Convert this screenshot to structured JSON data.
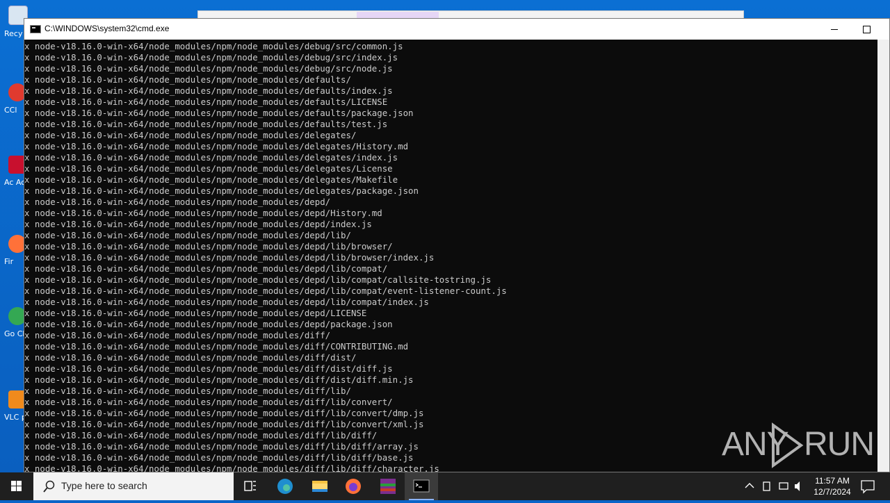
{
  "desktop": {
    "icons": [
      {
        "name": "recycle-bin",
        "label": "Recy"
      },
      {
        "name": "ccleaner",
        "label": "CCl"
      },
      {
        "name": "acrobat",
        "label": "Ac Acr"
      },
      {
        "name": "firefox",
        "label": "Fir"
      },
      {
        "name": "chrome",
        "label": "Go Chr"
      },
      {
        "name": "vlc",
        "label": "VLC pl"
      }
    ]
  },
  "window": {
    "title": "C:\\WINDOWS\\system32\\cmd.exe"
  },
  "console": {
    "lines": [
      "x node-v18.16.0-win-x64/node_modules/npm/node_modules/debug/src/common.js",
      "x node-v18.16.0-win-x64/node_modules/npm/node_modules/debug/src/index.js",
      "x node-v18.16.0-win-x64/node_modules/npm/node_modules/debug/src/node.js",
      "x node-v18.16.0-win-x64/node_modules/npm/node_modules/defaults/",
      "x node-v18.16.0-win-x64/node_modules/npm/node_modules/defaults/index.js",
      "x node-v18.16.0-win-x64/node_modules/npm/node_modules/defaults/LICENSE",
      "x node-v18.16.0-win-x64/node_modules/npm/node_modules/defaults/package.json",
      "x node-v18.16.0-win-x64/node_modules/npm/node_modules/defaults/test.js",
      "x node-v18.16.0-win-x64/node_modules/npm/node_modules/delegates/",
      "x node-v18.16.0-win-x64/node_modules/npm/node_modules/delegates/History.md",
      "x node-v18.16.0-win-x64/node_modules/npm/node_modules/delegates/index.js",
      "x node-v18.16.0-win-x64/node_modules/npm/node_modules/delegates/License",
      "x node-v18.16.0-win-x64/node_modules/npm/node_modules/delegates/Makefile",
      "x node-v18.16.0-win-x64/node_modules/npm/node_modules/delegates/package.json",
      "x node-v18.16.0-win-x64/node_modules/npm/node_modules/depd/",
      "x node-v18.16.0-win-x64/node_modules/npm/node_modules/depd/History.md",
      "x node-v18.16.0-win-x64/node_modules/npm/node_modules/depd/index.js",
      "x node-v18.16.0-win-x64/node_modules/npm/node_modules/depd/lib/",
      "x node-v18.16.0-win-x64/node_modules/npm/node_modules/depd/lib/browser/",
      "x node-v18.16.0-win-x64/node_modules/npm/node_modules/depd/lib/browser/index.js",
      "x node-v18.16.0-win-x64/node_modules/npm/node_modules/depd/lib/compat/",
      "x node-v18.16.0-win-x64/node_modules/npm/node_modules/depd/lib/compat/callsite-tostring.js",
      "x node-v18.16.0-win-x64/node_modules/npm/node_modules/depd/lib/compat/event-listener-count.js",
      "x node-v18.16.0-win-x64/node_modules/npm/node_modules/depd/lib/compat/index.js",
      "x node-v18.16.0-win-x64/node_modules/npm/node_modules/depd/LICENSE",
      "x node-v18.16.0-win-x64/node_modules/npm/node_modules/depd/package.json",
      "x node-v18.16.0-win-x64/node_modules/npm/node_modules/diff/",
      "x node-v18.16.0-win-x64/node_modules/npm/node_modules/diff/CONTRIBUTING.md",
      "x node-v18.16.0-win-x64/node_modules/npm/node_modules/diff/dist/",
      "x node-v18.16.0-win-x64/node_modules/npm/node_modules/diff/dist/diff.js",
      "x node-v18.16.0-win-x64/node_modules/npm/node_modules/diff/dist/diff.min.js",
      "x node-v18.16.0-win-x64/node_modules/npm/node_modules/diff/lib/",
      "x node-v18.16.0-win-x64/node_modules/npm/node_modules/diff/lib/convert/",
      "x node-v18.16.0-win-x64/node_modules/npm/node_modules/diff/lib/convert/dmp.js",
      "x node-v18.16.0-win-x64/node_modules/npm/node_modules/diff/lib/convert/xml.js",
      "x node-v18.16.0-win-x64/node_modules/npm/node_modules/diff/lib/diff/",
      "x node-v18.16.0-win-x64/node_modules/npm/node_modules/diff/lib/diff/array.js",
      "x node-v18.16.0-win-x64/node_modules/npm/node_modules/diff/lib/diff/base.js",
      "x node-v18.16.0-win-x64/node_modules/npm/node_modules/diff/lib/diff/character.js"
    ]
  },
  "watermark": {
    "left": "ANY",
    "right": "RUN"
  },
  "taskbar": {
    "search_placeholder": "Type here to search",
    "apps": [
      {
        "name": "task-view"
      },
      {
        "name": "edge"
      },
      {
        "name": "file-explorer"
      },
      {
        "name": "firefox"
      },
      {
        "name": "winrar"
      },
      {
        "name": "cmd",
        "active": true
      }
    ],
    "time": "11:57 AM",
    "date": "12/7/2024"
  },
  "colors": {
    "desktop": "#0a64c8",
    "console_bg": "#0c0c0c",
    "console_text": "#cccccc",
    "taskbar": "#1f1f1f"
  }
}
